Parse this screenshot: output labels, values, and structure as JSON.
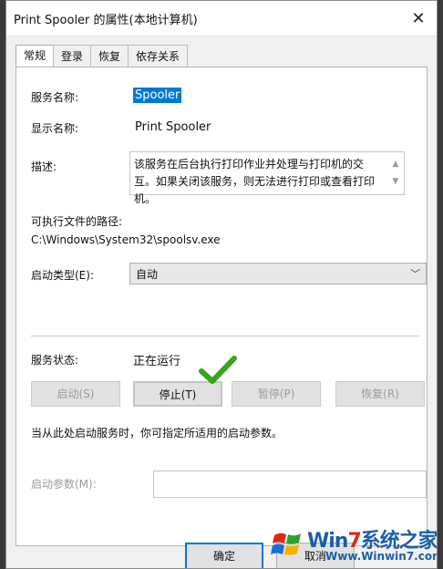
{
  "window": {
    "title": "Print Spooler 的属性(本地计算机)",
    "close_glyph": "✕"
  },
  "tabs": [
    "常规",
    "登录",
    "恢复",
    "依存关系"
  ],
  "general": {
    "service_name_label": "服务名称:",
    "service_name_value": "Spooler",
    "display_name_label": "显示名称:",
    "display_name_value": "Print Spooler",
    "description_label": "描述:",
    "description_value": "该服务在后台执行打印作业并处理与打印机的交互。如果关闭该服务，则无法进行打印或查看打印机。",
    "path_label": "可执行文件的路径:",
    "path_value": "C:\\Windows\\System32\\spoolsv.exe",
    "startup_type_label": "启动类型(E):",
    "startup_type_value": "自动",
    "status_label": "服务状态:",
    "status_value": "正在运行",
    "buttons": {
      "start": "启动(S)",
      "stop": "停止(T)",
      "pause": "暂停(P)",
      "resume": "恢复(R)"
    },
    "hint": "当从此处启动服务时，你可指定所适用的启动参数。",
    "start_params_label": "启动参数(M):",
    "start_params_value": ""
  },
  "footer": {
    "ok": "确定",
    "cancel": "取消"
  },
  "watermark": {
    "brand_win": "Win",
    "brand_seven": "7",
    "brand_rest": "系统之家",
    "url": "Www.Winwin7.com"
  },
  "colors": {
    "accent": "#0078d7",
    "check": "#3aa31f"
  }
}
